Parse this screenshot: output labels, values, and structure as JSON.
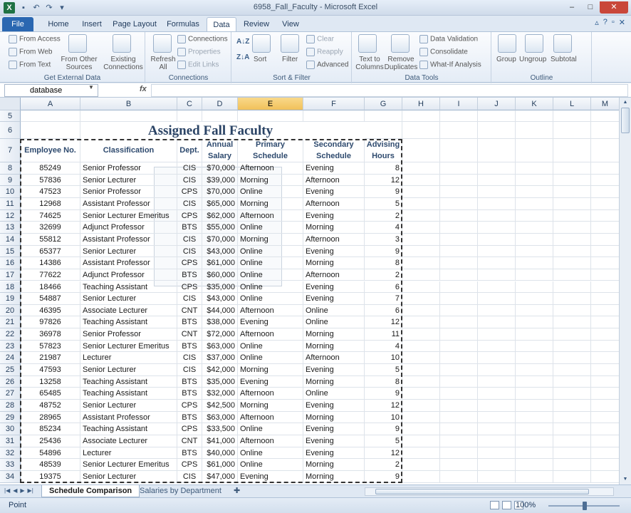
{
  "window": {
    "title": "6958_Fall_Faculty - Microsoft Excel",
    "controls": {
      "minimize": "–",
      "maximize": "□",
      "close": "✕"
    }
  },
  "ribbon_tabs": [
    "File",
    "Home",
    "Insert",
    "Page Layout",
    "Formulas",
    "Data",
    "Review",
    "View"
  ],
  "active_tab": "Data",
  "ribbon": {
    "get_external_data": {
      "label": "Get External Data",
      "from_access": "From Access",
      "from_web": "From Web",
      "from_text": "From Text",
      "from_other_sources": "From Other Sources",
      "existing_connections": "Existing Connections"
    },
    "connections": {
      "label": "Connections",
      "refresh_all": "Refresh All",
      "connections": "Connections",
      "properties": "Properties",
      "edit_links": "Edit Links"
    },
    "sort_filter": {
      "label": "Sort & Filter",
      "sort": "Sort",
      "filter": "Filter",
      "clear": "Clear",
      "reapply": "Reapply",
      "advanced": "Advanced"
    },
    "data_tools": {
      "label": "Data Tools",
      "text_to_columns": "Text to Columns",
      "remove_duplicates": "Remove Duplicates",
      "data_validation": "Data Validation",
      "consolidate": "Consolidate",
      "what_if": "What-If Analysis"
    },
    "outline": {
      "label": "Outline",
      "group": "Group",
      "ungroup": "Ungroup",
      "subtotal": "Subtotal"
    }
  },
  "formula_bar": {
    "name_box": "database",
    "fx": "fx",
    "value": ""
  },
  "columns": [
    "A",
    "B",
    "C",
    "D",
    "E",
    "F",
    "G",
    "H",
    "I",
    "J",
    "K",
    "L",
    "M"
  ],
  "selected_column": "E",
  "sheet": {
    "title": "Assigned Fall Faculty",
    "headers": {
      "employee_no": "Employee No.",
      "classification": "Classification",
      "dept": "Dept.",
      "annual_salary": [
        "Annual",
        "Salary"
      ],
      "primary_schedule": [
        "Primary",
        "Schedule"
      ],
      "secondary_schedule": [
        "Secondary",
        "Schedule"
      ],
      "advising_hours": [
        "Advising",
        "Hours"
      ]
    },
    "rows": [
      {
        "row": "8",
        "emp": "85249",
        "cls": "Senior Professor",
        "dept": "CIS",
        "salary": "$70,000",
        "primary": "Afternoon",
        "secondary": "Evening",
        "hours": "8"
      },
      {
        "row": "9",
        "emp": "57836",
        "cls": "Senior Lecturer",
        "dept": "CIS",
        "salary": "$39,000",
        "primary": "Morning",
        "secondary": "Afternoon",
        "hours": "12"
      },
      {
        "row": "10",
        "emp": "47523",
        "cls": "Senior Professor",
        "dept": "CPS",
        "salary": "$70,000",
        "primary": "Online",
        "secondary": "Evening",
        "hours": "9"
      },
      {
        "row": "11",
        "emp": "12968",
        "cls": "Assistant Professor",
        "dept": "CIS",
        "salary": "$65,000",
        "primary": "Morning",
        "secondary": "Afternoon",
        "hours": "5"
      },
      {
        "row": "12",
        "emp": "74625",
        "cls": "Senior Lecturer Emeritus",
        "dept": "CPS",
        "salary": "$62,000",
        "primary": "Afternoon",
        "secondary": "Evening",
        "hours": "2"
      },
      {
        "row": "13",
        "emp": "32699",
        "cls": "Adjunct Professor",
        "dept": "BTS",
        "salary": "$55,000",
        "primary": "Online",
        "secondary": "Morning",
        "hours": "4"
      },
      {
        "row": "14",
        "emp": "55812",
        "cls": "Assistant Professor",
        "dept": "CIS",
        "salary": "$70,000",
        "primary": "Morning",
        "secondary": "Afternoon",
        "hours": "3"
      },
      {
        "row": "15",
        "emp": "65377",
        "cls": "Senior Lecturer",
        "dept": "CIS",
        "salary": "$43,000",
        "primary": "Online",
        "secondary": "Evening",
        "hours": "9"
      },
      {
        "row": "16",
        "emp": "14386",
        "cls": "Assistant Professor",
        "dept": "CPS",
        "salary": "$61,000",
        "primary": "Online",
        "secondary": "Morning",
        "hours": "8"
      },
      {
        "row": "17",
        "emp": "77622",
        "cls": "Adjunct Professor",
        "dept": "BTS",
        "salary": "$60,000",
        "primary": "Online",
        "secondary": "Afternoon",
        "hours": "2"
      },
      {
        "row": "18",
        "emp": "18466",
        "cls": "Teaching Assistant",
        "dept": "CPS",
        "salary": "$35,000",
        "primary": "Online",
        "secondary": "Evening",
        "hours": "6"
      },
      {
        "row": "19",
        "emp": "54887",
        "cls": "Senior Lecturer",
        "dept": "CIS",
        "salary": "$43,000",
        "primary": "Online",
        "secondary": "Evening",
        "hours": "7"
      },
      {
        "row": "20",
        "emp": "46395",
        "cls": "Associate Lecturer",
        "dept": "CNT",
        "salary": "$44,000",
        "primary": "Afternoon",
        "secondary": "Online",
        "hours": "6"
      },
      {
        "row": "21",
        "emp": "97826",
        "cls": "Teaching Assistant",
        "dept": "BTS",
        "salary": "$38,000",
        "primary": "Evening",
        "secondary": "Online",
        "hours": "12"
      },
      {
        "row": "22",
        "emp": "36978",
        "cls": "Senior Professor",
        "dept": "CNT",
        "salary": "$72,000",
        "primary": "Afternoon",
        "secondary": "Morning",
        "hours": "11"
      },
      {
        "row": "23",
        "emp": "57823",
        "cls": "Senior Lecturer Emeritus",
        "dept": "BTS",
        "salary": "$63,000",
        "primary": "Online",
        "secondary": "Morning",
        "hours": "4"
      },
      {
        "row": "24",
        "emp": "21987",
        "cls": "Lecturer",
        "dept": "CIS",
        "salary": "$37,000",
        "primary": "Online",
        "secondary": "Afternoon",
        "hours": "10"
      },
      {
        "row": "25",
        "emp": "47593",
        "cls": "Senior Lecturer",
        "dept": "CIS",
        "salary": "$42,000",
        "primary": "Morning",
        "secondary": "Evening",
        "hours": "5"
      },
      {
        "row": "26",
        "emp": "13258",
        "cls": "Teaching Assistant",
        "dept": "BTS",
        "salary": "$35,000",
        "primary": "Evening",
        "secondary": "Morning",
        "hours": "8"
      },
      {
        "row": "27",
        "emp": "65485",
        "cls": "Teaching Assistant",
        "dept": "BTS",
        "salary": "$32,000",
        "primary": "Afternoon",
        "secondary": "Online",
        "hours": "9"
      },
      {
        "row": "28",
        "emp": "48752",
        "cls": "Senior Lecturer",
        "dept": "CPS",
        "salary": "$42,500",
        "primary": "Morning",
        "secondary": "Evening",
        "hours": "12"
      },
      {
        "row": "29",
        "emp": "28965",
        "cls": "Assistant Professor",
        "dept": "BTS",
        "salary": "$63,000",
        "primary": "Afternoon",
        "secondary": "Morning",
        "hours": "10"
      },
      {
        "row": "30",
        "emp": "85234",
        "cls": "Teaching Assistant",
        "dept": "CPS",
        "salary": "$33,500",
        "primary": "Online",
        "secondary": "Evening",
        "hours": "9"
      },
      {
        "row": "31",
        "emp": "25436",
        "cls": "Associate Lecturer",
        "dept": "CNT",
        "salary": "$41,000",
        "primary": "Afternoon",
        "secondary": "Evening",
        "hours": "5"
      },
      {
        "row": "32",
        "emp": "54896",
        "cls": "Lecturer",
        "dept": "BTS",
        "salary": "$40,000",
        "primary": "Online",
        "secondary": "Evening",
        "hours": "12"
      },
      {
        "row": "33",
        "emp": "48539",
        "cls": "Senior Lecturer Emeritus",
        "dept": "CPS",
        "salary": "$61,000",
        "primary": "Online",
        "secondary": "Morning",
        "hours": "2"
      },
      {
        "row": "34",
        "emp": "19375",
        "cls": "Senior Lecturer",
        "dept": "CIS",
        "salary": "$47,000",
        "primary": "Evening",
        "secondary": "Morning",
        "hours": "9"
      }
    ]
  },
  "sheet_tabs": [
    "Schedule Comparison",
    "Salaries by Department"
  ],
  "active_sheet": "Schedule Comparison",
  "status": {
    "mode": "Point",
    "zoom": "100%"
  }
}
